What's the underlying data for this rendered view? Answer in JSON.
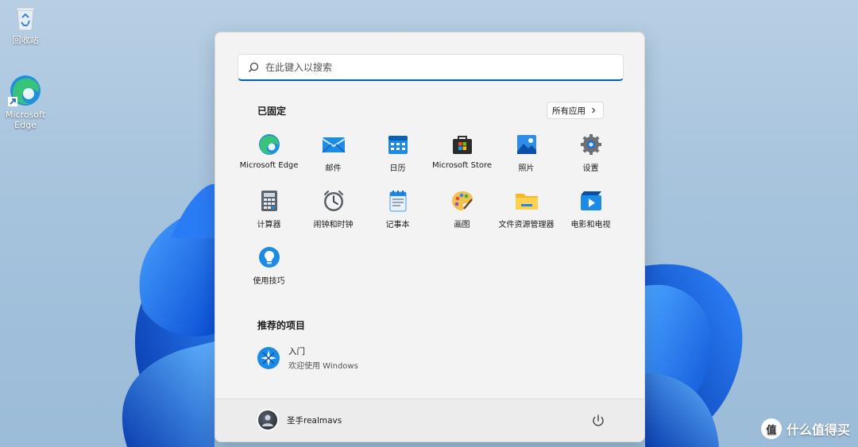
{
  "desktop": {
    "icons": [
      {
        "label": "回收站",
        "icon": "recycle-bin-icon"
      },
      {
        "label": "Microsoft Edge",
        "icon": "edge-icon"
      }
    ]
  },
  "start_menu": {
    "search": {
      "placeholder": "在此键入以搜索",
      "icon": "search-icon"
    },
    "pinned": {
      "title": "已固定",
      "all_apps_label": "所有应用",
      "apps": [
        {
          "label": "Microsoft Edge",
          "icon": "edge-icon"
        },
        {
          "label": "邮件",
          "icon": "mail-icon"
        },
        {
          "label": "日历",
          "icon": "calendar-icon"
        },
        {
          "label": "Microsoft Store",
          "icon": "store-icon"
        },
        {
          "label": "照片",
          "icon": "photos-icon"
        },
        {
          "label": "设置",
          "icon": "settings-gear-icon"
        },
        {
          "label": "计算器",
          "icon": "calculator-icon"
        },
        {
          "label": "闹钟和时钟",
          "icon": "alarm-clock-icon"
        },
        {
          "label": "记事本",
          "icon": "notepad-icon"
        },
        {
          "label": "画图",
          "icon": "paint-palette-icon"
        },
        {
          "label": "文件资源管理器",
          "icon": "folder-icon"
        },
        {
          "label": "电影和电视",
          "icon": "movies-tv-icon"
        },
        {
          "label": "使用技巧",
          "icon": "tips-lightbulb-icon"
        }
      ]
    },
    "recommended": {
      "title": "推荐的项目",
      "items": [
        {
          "title": "入门",
          "subtitle": "欢迎使用 Windows",
          "icon": "get-started-icon"
        }
      ]
    },
    "footer": {
      "user_name": "圣手realmavs",
      "power_icon": "power-icon"
    }
  },
  "watermark": {
    "text": "什么值得买",
    "logo": "值"
  },
  "colors": {
    "accent": "#005fb8",
    "menu_bg": "#f3f3f3",
    "bloom": "#1a6cf0"
  }
}
